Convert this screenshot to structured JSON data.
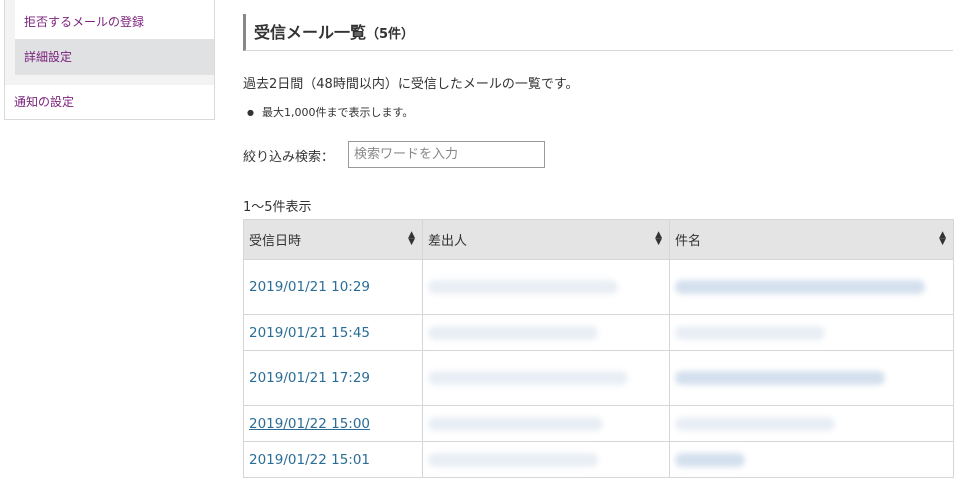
{
  "sidebar": {
    "sub_items": [
      {
        "label": "拒否するメールの登録"
      },
      {
        "label": "詳細設定"
      }
    ],
    "top_items": [
      {
        "label": "通知の設定"
      }
    ]
  },
  "page": {
    "title": "受信メール一覧",
    "title_count": "（5件）",
    "lead": "過去2日間（48時間以内）に受信したメールの一覧です。",
    "note": "最大1,000件まで表示します。",
    "bullet": "●"
  },
  "filter": {
    "label": "絞り込み検索：",
    "placeholder": "検索ワードを入力",
    "value": ""
  },
  "list": {
    "range_text": "1〜5件表示",
    "columns": [
      "受信日時",
      "差出人",
      "件名"
    ],
    "rows": [
      {
        "received": "2019/01/21 10:29",
        "sender": "",
        "subject": ""
      },
      {
        "received": "2019/01/21 15:45",
        "sender": "",
        "subject": ""
      },
      {
        "received": "2019/01/21 17:29",
        "sender": "",
        "subject": ""
      },
      {
        "received": "2019/01/22 15:00",
        "sender": "",
        "subject": ""
      },
      {
        "received": "2019/01/22 15:01",
        "sender": "",
        "subject": ""
      }
    ]
  },
  "colors": {
    "link": "#2a6d96",
    "sidebar_link": "#7a1f7a",
    "header_bg": "#e4e4e4",
    "active_bg": "#dfe1e3"
  },
  "icons": [
    "sort-icon"
  ]
}
